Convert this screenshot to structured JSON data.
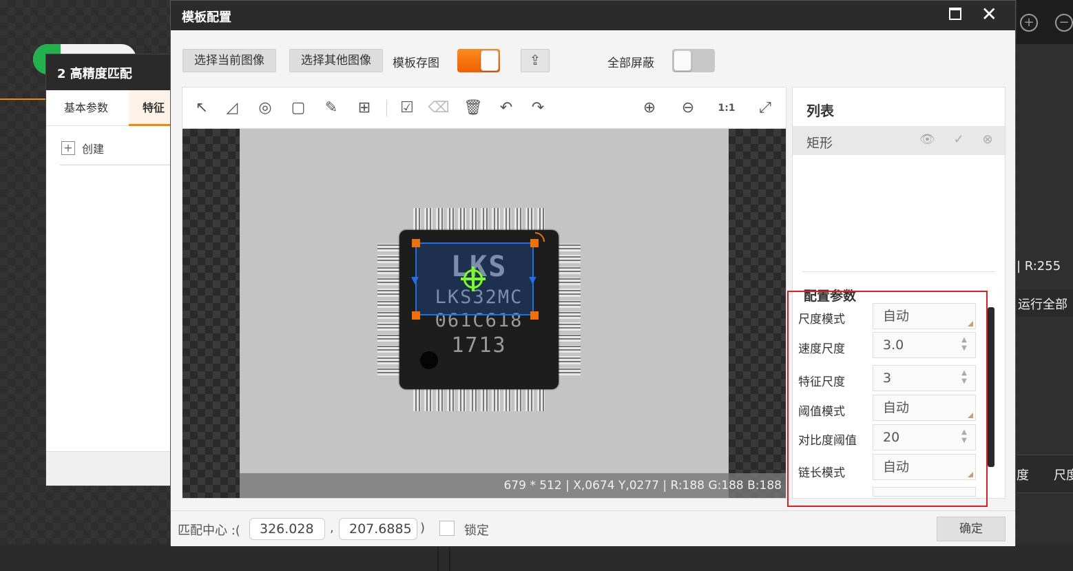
{
  "background": {
    "left_panel": {
      "title": "2 高精度匹配",
      "tabs": [
        "基本参数",
        "特征"
      ],
      "create_label": "创建"
    },
    "right_panel": {
      "zoom_in_icon": "zoom-in-icon",
      "zoom_out_icon": "zoom-out-icon",
      "r_readout": "| R:255",
      "run_all_label": "运行全部",
      "col_partial_1": "度",
      "col_partial_2": "尺度"
    }
  },
  "dialog": {
    "title": "模板配置",
    "toolbar": {
      "select_current_image": "选择当前图像",
      "select_other_image": "选择其他图像",
      "save_template_image_label": "模板存图",
      "save_template_image_on": true,
      "mask_all_label": "全部屏蔽",
      "mask_all_on": false
    },
    "canvas_tools": [
      "select-arrow-icon",
      "polygon-icon",
      "circle-icon",
      "rectangle-icon",
      "pen-icon",
      "add-point-icon",
      "apply-mask-icon",
      "eraser-icon",
      "delete-icon",
      "undo-icon",
      "redo-icon",
      "zoom-in-icon",
      "zoom-out-icon",
      "actual-size-icon",
      "fit-window-icon"
    ],
    "actual_size_label": "1:1",
    "image": {
      "chip_line1": "LKS",
      "chip_line2": "LKS32MC",
      "chip_line3": "061C618",
      "chip_line4": "1713"
    },
    "status": "679 * 512  |  X,0674  Y,0277  |  R:188  G:188  B:188",
    "list": {
      "title": "列表",
      "items": [
        {
          "label": "矩形"
        }
      ]
    },
    "config": {
      "title": "配置参数",
      "fields": [
        {
          "label": "尺度模式",
          "value": "自动",
          "type": "select"
        },
        {
          "label": "速度尺度",
          "value": "3.0",
          "type": "spin"
        },
        {
          "label": "特征尺度",
          "value": "3",
          "type": "spin"
        },
        {
          "label": "阈值模式",
          "value": "自动",
          "type": "select"
        },
        {
          "label": "对比度阈值",
          "value": "20",
          "type": "spin"
        },
        {
          "label": "链长模式",
          "value": "自动",
          "type": "select"
        }
      ]
    },
    "footer": {
      "match_center_label": "匹配中心 :(",
      "center_x": "326.028",
      "comma": ",",
      "center_y": "207.6885",
      "close_paren": ")",
      "lock_label": "锁定",
      "ok_label": "确定"
    }
  },
  "colors": {
    "accent": "#f08a00",
    "roi": "#1e6fe8",
    "center_marker": "#7aff1e",
    "highlight_box": "#e02020"
  }
}
